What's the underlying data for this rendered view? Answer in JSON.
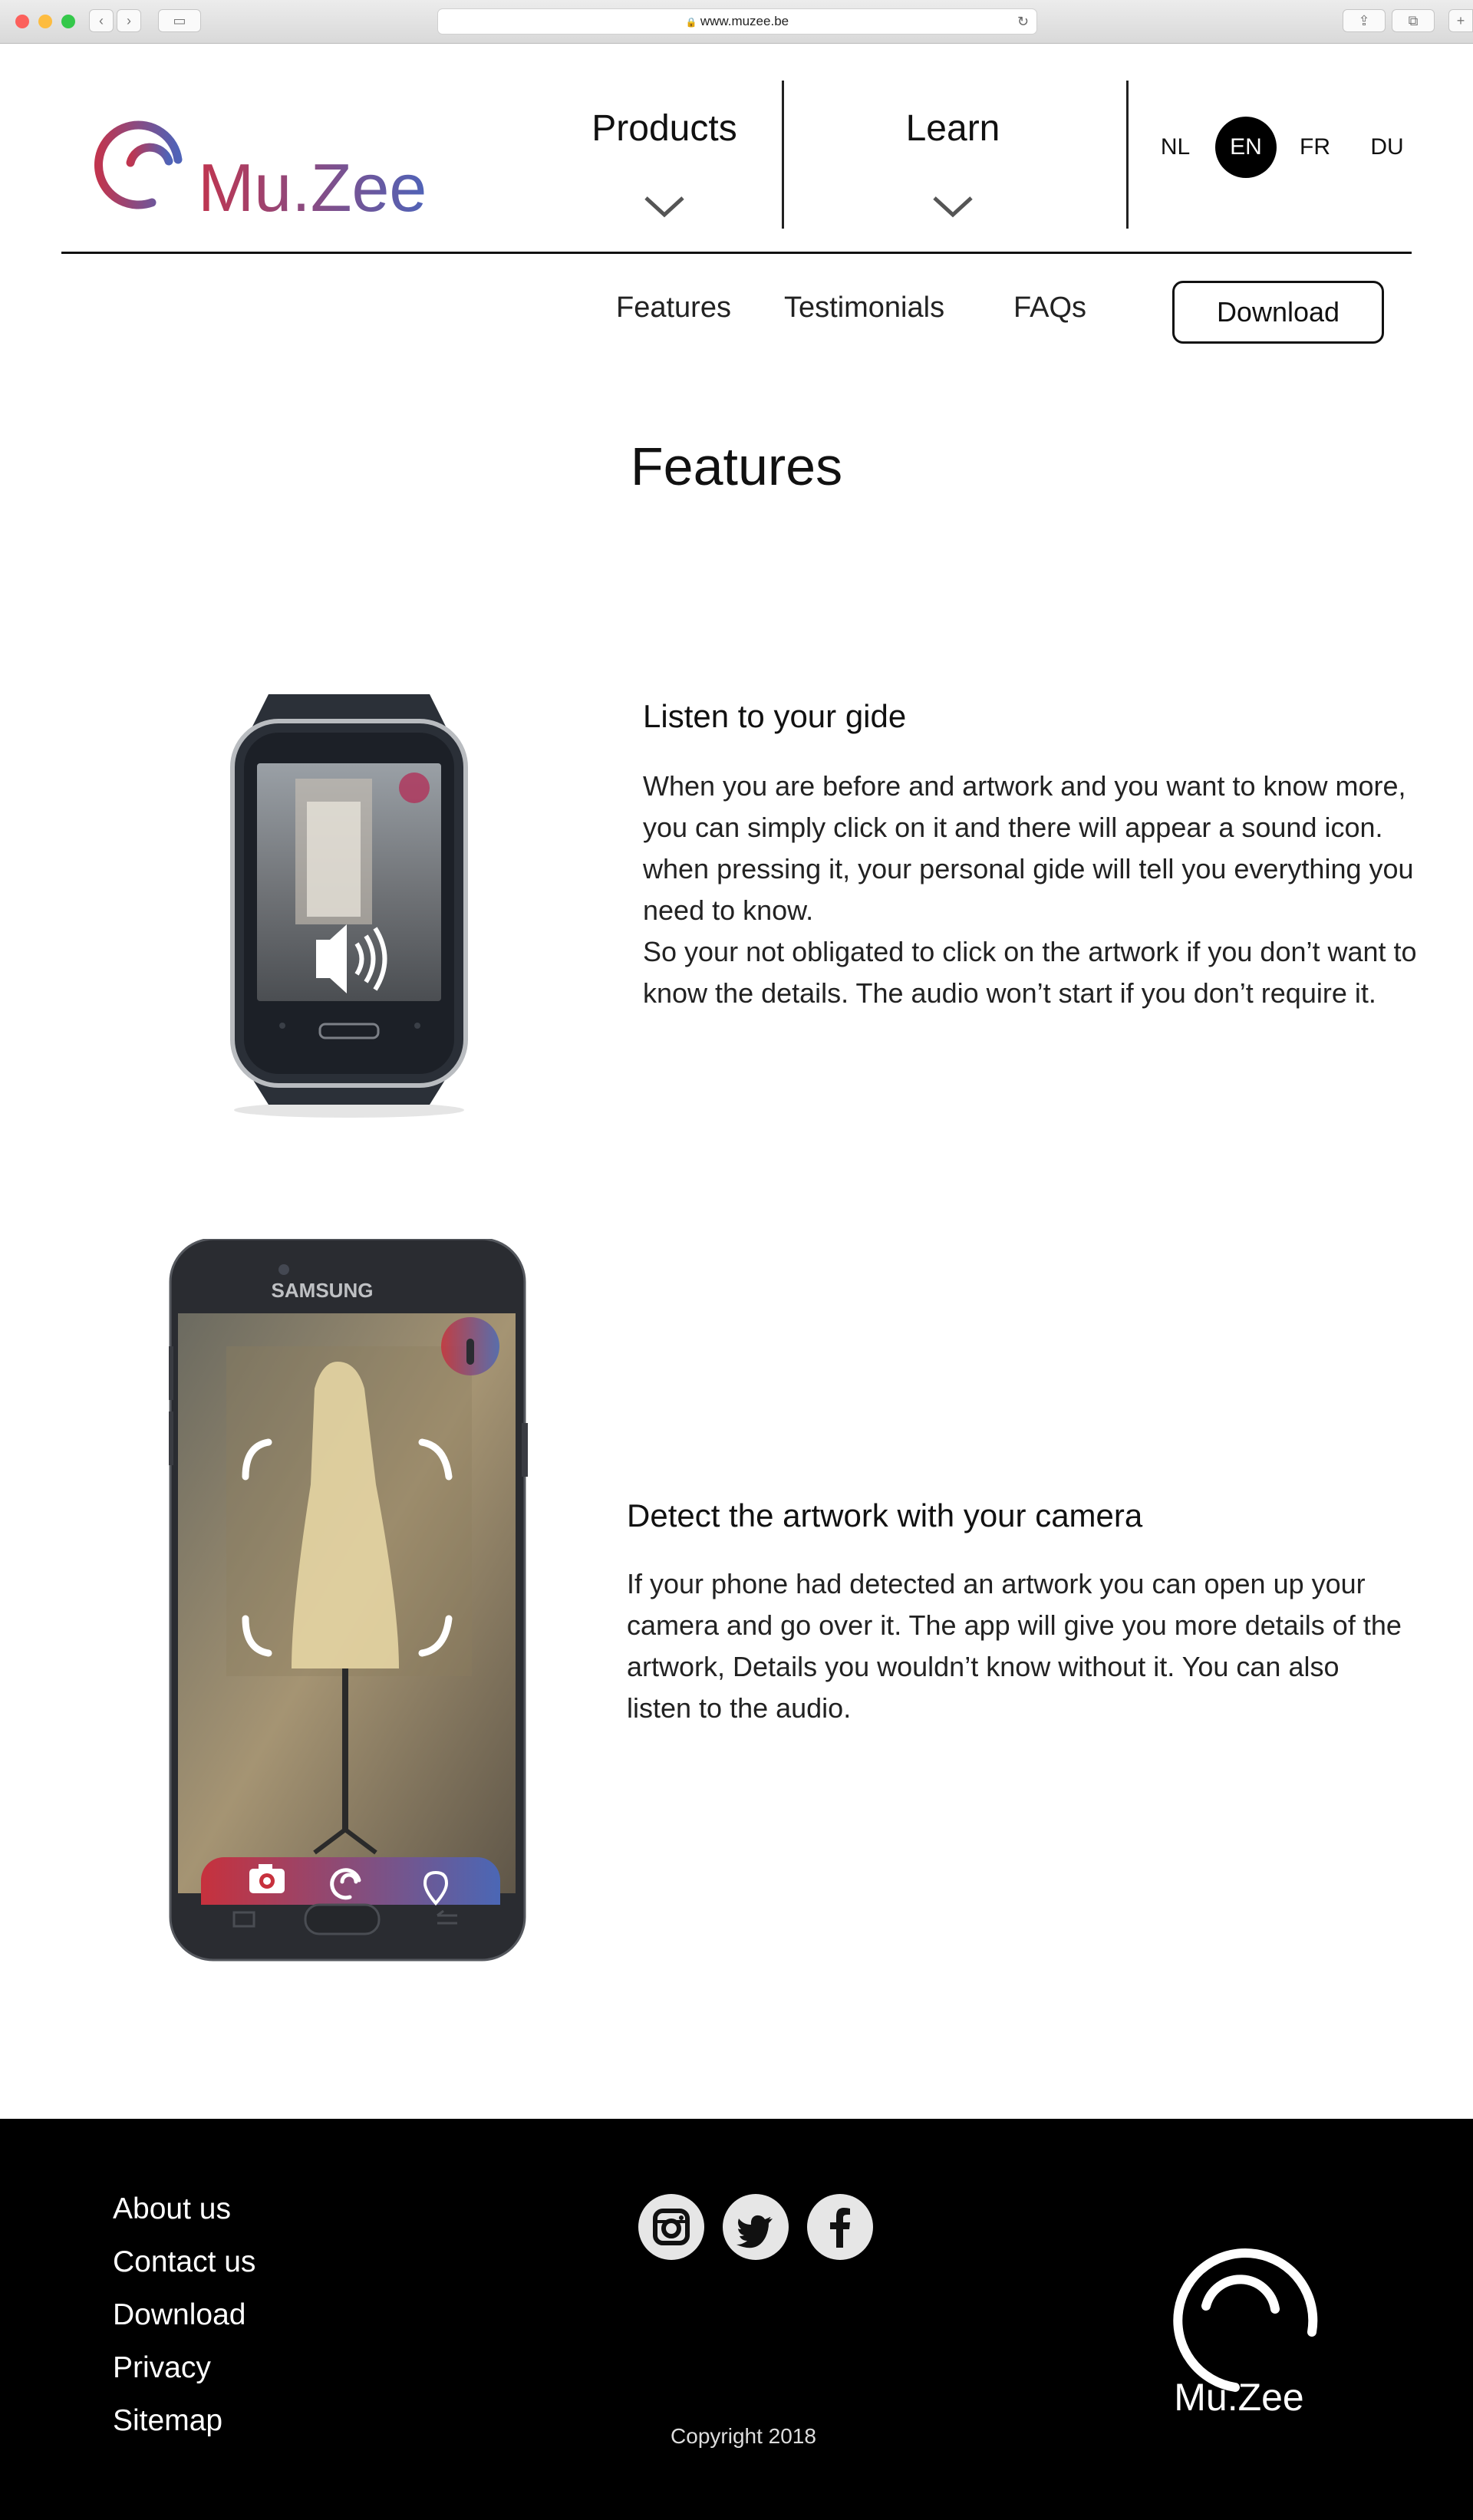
{
  "browser": {
    "url": "www.muzee.be",
    "icons": [
      "back-icon",
      "forward-icon",
      "sidebar-icon",
      "lock-icon",
      "reload-icon",
      "share-icon",
      "tabs-icon",
      "new-tab-icon"
    ]
  },
  "brand": {
    "name": "Mu.Zee",
    "gradient_start": "#c0354f",
    "gradient_end": "#4f63b8"
  },
  "nav": {
    "products": "Products",
    "learn": "Learn",
    "languages": [
      "NL",
      "EN",
      "FR",
      "DU"
    ],
    "active_language": "EN"
  },
  "subnav": {
    "features": "Features",
    "testimonials": "Testimonials",
    "faqs": "FAQs",
    "download": "Download"
  },
  "page": {
    "title": "Features"
  },
  "features": [
    {
      "title": "Listen to your gide",
      "paragraphs": [
        "When you are before and artwork and you want to know more, you can simply click on it and there will appear a sound icon. when pressing it, your personal gide will tell you everything you need to know.",
        "So your not obligated to click on the artwork if you don’t want to know the details. The audio won’t start if you don’t require it."
      ],
      "device_icon": "speaker-icon"
    },
    {
      "title": "Detect the artwork with your camera",
      "paragraphs": [
        "If your phone had detected an artwork you can open up your camera and go over it. The app will give you more details of the artwork, Details you wouldn’t know without it. You can also listen to the audio."
      ],
      "phone_brand": "SAMSUNG",
      "phone_icons": [
        "camera-icon",
        "muzee-icon",
        "location-pin-icon"
      ]
    }
  ],
  "footer": {
    "links": [
      "About us",
      "Contact us",
      "Download",
      "Privacy",
      "Sitemap"
    ],
    "social": [
      "instagram-icon",
      "twitter-icon",
      "facebook-icon"
    ],
    "copyright": "Copyright 2018",
    "logo_text": "Mu.Zee"
  }
}
